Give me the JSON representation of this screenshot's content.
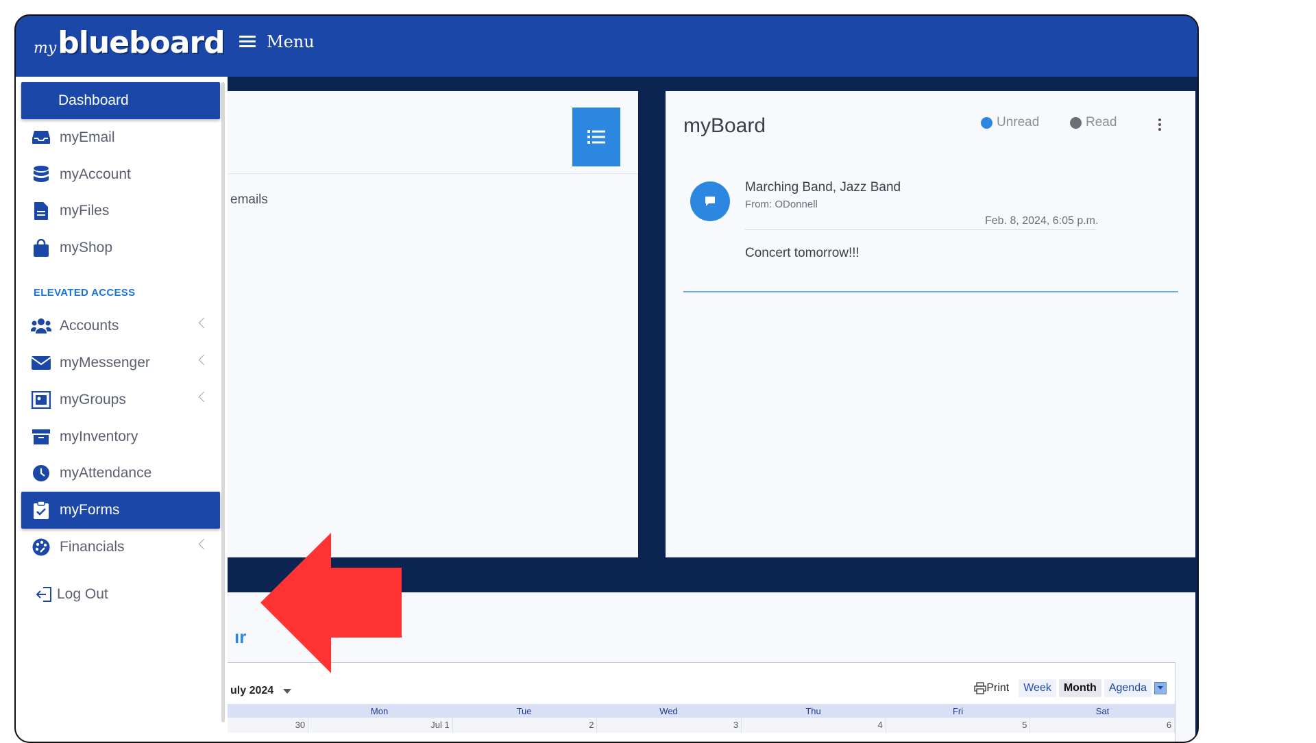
{
  "header": {
    "logo_prefix": "my",
    "logo_main": "blueboard",
    "menu_label": "Menu"
  },
  "sidebar": {
    "dashboard": "Dashboard",
    "items": [
      {
        "label": "myEmail",
        "icon": "inbox-icon"
      },
      {
        "label": "myAccount",
        "icon": "database-icon"
      },
      {
        "label": "myFiles",
        "icon": "file-icon"
      },
      {
        "label": "myShop",
        "icon": "shopping-bag-icon"
      }
    ],
    "section_title": "ELEVATED ACCESS",
    "elevated_items": [
      {
        "label": "Accounts",
        "icon": "users-icon"
      },
      {
        "label": "myMessenger",
        "icon": "envelope-icon"
      },
      {
        "label": "myGroups",
        "icon": "group-image-icon"
      },
      {
        "label": "myInventory",
        "icon": "archive-box-icon"
      },
      {
        "label": "myAttendance",
        "icon": "clock-icon"
      },
      {
        "label": "myForms",
        "icon": "clipboard-check-icon"
      },
      {
        "label": "Financials",
        "icon": "palette-icon"
      }
    ],
    "logout": "Log Out"
  },
  "left_panel": {
    "emails_text": "emails"
  },
  "myboard": {
    "title": "myBoard",
    "legend_unread": "Unread",
    "legend_read": "Read",
    "message": {
      "sender": "Marching Band, Jazz Band",
      "from": "From: ODonnell",
      "date": "Feb. 8, 2024, 6:05 p.m.",
      "body": "Concert tomorrow!!!"
    }
  },
  "calendar": {
    "title_fragment": "ır",
    "month": "uly 2024",
    "print": "Print",
    "tabs": [
      "Week",
      "Month",
      "Agenda"
    ],
    "active_tab": "Month",
    "weekdays": [
      "",
      "Mon",
      "Tue",
      "Wed",
      "Thu",
      "Fri",
      "Sat"
    ],
    "first_row": [
      "30",
      "Jul 1",
      "2",
      "3",
      "4",
      "5",
      "6"
    ]
  },
  "colors": {
    "brand_blue": "#1b48a8",
    "accent_blue": "#2b87e0",
    "navy_bg": "#0b2452",
    "arrow_red": "#ff3333"
  }
}
